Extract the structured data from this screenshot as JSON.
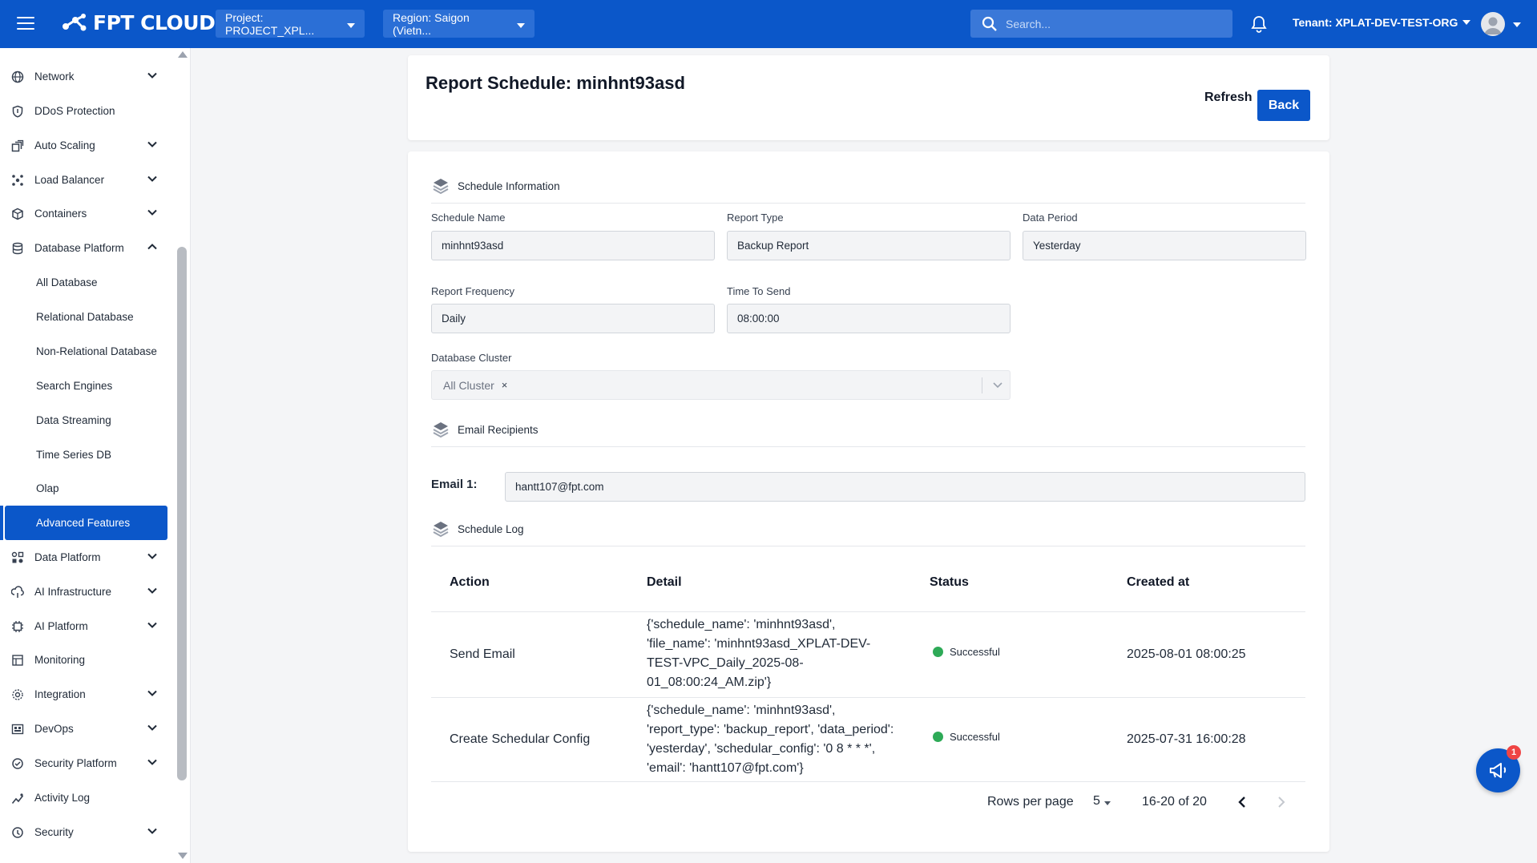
{
  "topbar": {
    "logo_text": "FPT CLOUD",
    "project": "Project: PROJECT_XPL...",
    "region": "Region: Saigon (Vietn...",
    "search_placeholder": "Search...",
    "tenant": "Tenant: XPLAT-DEV-TEST-ORG"
  },
  "sidebar": {
    "items": [
      {
        "label": "Network",
        "icon": "network-icon"
      },
      {
        "label": "DDoS Protection",
        "icon": "shield-icon"
      },
      {
        "label": "Auto Scaling",
        "icon": "scaling-icon"
      },
      {
        "label": "Load Balancer",
        "icon": "load-balancer-icon"
      },
      {
        "label": "Containers",
        "icon": "container-icon"
      },
      {
        "label": "Database Platform",
        "icon": "database-icon"
      },
      {
        "label": "Data Platform",
        "icon": "data-platform-icon"
      },
      {
        "label": "AI Infrastructure",
        "icon": "ai-infra-icon"
      },
      {
        "label": "AI Platform",
        "icon": "chip-icon"
      },
      {
        "label": "Monitoring",
        "icon": "monitor-icon"
      },
      {
        "label": "Integration",
        "icon": "integration-icon"
      },
      {
        "label": "DevOps",
        "icon": "devops-icon"
      },
      {
        "label": "Security Platform",
        "icon": "security-platform-icon"
      },
      {
        "label": "Activity Log",
        "icon": "activity-icon"
      },
      {
        "label": "Security",
        "icon": "lock-icon"
      }
    ],
    "sub_items": [
      "All Database",
      "Relational Database",
      "Non-Relational Database",
      "Search Engines",
      "Data Streaming",
      "Time Series DB",
      "Olap",
      "Advanced Features"
    ]
  },
  "header": {
    "title": "Report Schedule: minhnt93asd",
    "refresh_label": "Refresh",
    "back_label": "Back"
  },
  "schedule_info": {
    "section_title": "Schedule Information",
    "schedule_name_label": "Schedule Name",
    "schedule_name": "minhnt93asd",
    "report_type_label": "Report Type",
    "report_type": "Backup Report",
    "data_period_label": "Data Period",
    "data_period": "Yesterday",
    "report_frequency_label": "Report Frequency",
    "report_frequency": "Daily",
    "time_to_send_label": "Time To Send",
    "time_to_send": "08:00:00",
    "database_cluster_label": "Database Cluster",
    "database_cluster": "All Cluster",
    "chip_remove": "×"
  },
  "email": {
    "section_title": "Email Recipients",
    "email1_label": "Email 1:",
    "email1": "hantt107@fpt.com"
  },
  "log": {
    "section_title": "Schedule Log",
    "columns": [
      "Action",
      "Detail",
      "Status",
      "Created at"
    ],
    "rows": [
      {
        "action": "Send Email",
        "detail": [
          "{'schedule_name': 'minhnt93asd',",
          "'file_name': 'minhnt93asd_XPLAT-DEV-",
          "TEST-VPC_Daily_2025-08-",
          "01_08:00:24_AM.zip'}"
        ],
        "status": "Successful",
        "created": "2025-08-01 08:00:25"
      },
      {
        "action": "Create Schedular Config",
        "detail": [
          "{'schedule_name': 'minhnt93asd',",
          "'report_type': 'backup_report', 'data_period':",
          "'yesterday', 'schedular_config': '0 8 * * *',",
          "'email': 'hantt107@fpt.com'}"
        ],
        "status": "Successful",
        "created": "2025-07-31 16:00:28"
      }
    ],
    "rows_per_page_label": "Rows per page",
    "rows_per_page": "5",
    "range": "16-20 of 20"
  },
  "fab": {
    "badge": "1"
  },
  "colors": {
    "primary": "#0b57c9",
    "success": "#2eaa57",
    "badge": "#ef4444"
  }
}
